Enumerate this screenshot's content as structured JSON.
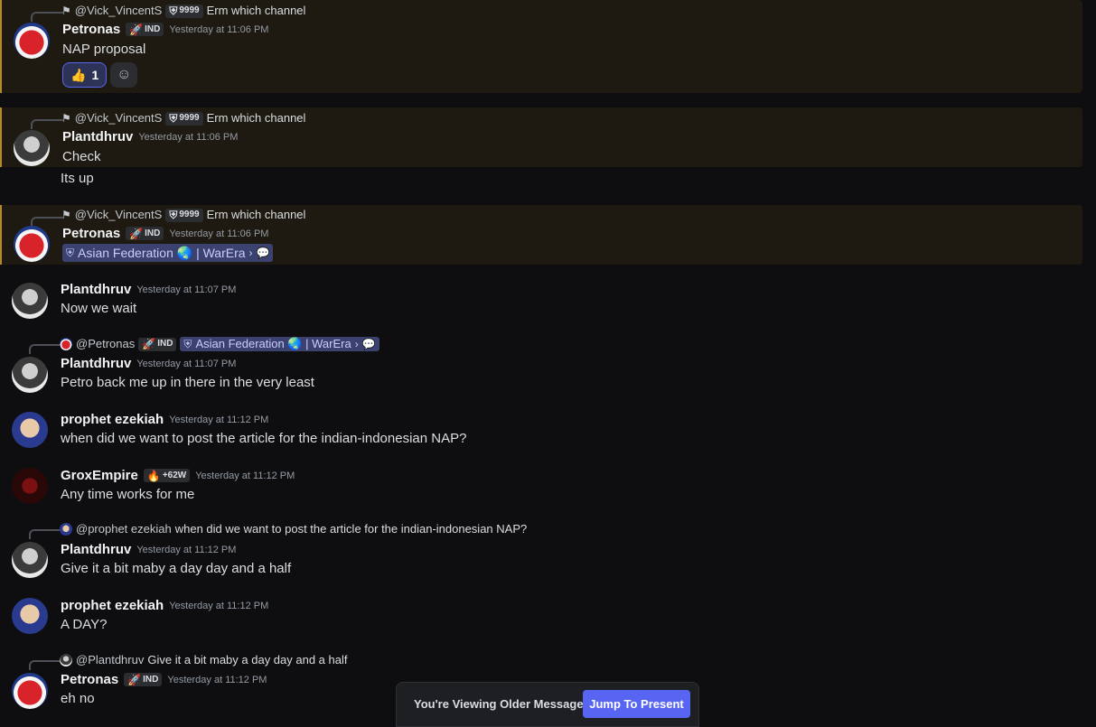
{
  "messages": [
    {
      "reply": {
        "user": "@Vick_VincentS",
        "tag": "9999",
        "text": "Erm which channel"
      },
      "user": "Petronas",
      "tag": "IND",
      "time": "Yesterday at 11:06 PM",
      "text": "NAP proposal",
      "reaction": {
        "emoji": "👍",
        "count": "1"
      }
    },
    {
      "reply": {
        "user": "@Vick_VincentS",
        "tag": "9999",
        "text": "Erm which channel"
      },
      "user": "Plantdhruv",
      "time": "Yesterday at 11:06 PM",
      "text": "Check",
      "followup": "Its up"
    },
    {
      "reply": {
        "user": "@Vick_VincentS",
        "tag": "9999",
        "text": "Erm which channel"
      },
      "user": "Petronas",
      "tag": "IND",
      "time": "Yesterday at 11:06 PM",
      "channel": "Asian Federation 🌏 | WarEra"
    },
    {
      "user": "Plantdhruv",
      "time": "Yesterday at 11:07 PM",
      "text": "Now we wait"
    },
    {
      "reply": {
        "user": "@Petronas",
        "tag": "IND",
        "channel": "Asian Federation 🌏 | WarEra"
      },
      "user": "Plantdhruv",
      "time": "Yesterday at 11:07 PM",
      "text": "Petro back me up in there in the very least"
    },
    {
      "user": "prophet ezekiah",
      "time": "Yesterday at 11:12 PM",
      "text": "when did we want to post the article for the indian-indonesian NAP?"
    },
    {
      "user": "GroxEmpire",
      "tag": "+62W",
      "time": "Yesterday at 11:12 PM",
      "text": "Any time works for me"
    },
    {
      "reply": {
        "user": "@prophet ezekiah",
        "text": "when did we want to post the article for the indian-indonesian NAP?"
      },
      "user": "Plantdhruv",
      "time": "Yesterday at 11:12 PM",
      "text": "Give it a bit maby a day day and a half"
    },
    {
      "user": "prophet ezekiah",
      "time": "Yesterday at 11:12 PM",
      "text": "A DAY?"
    },
    {
      "reply": {
        "user": "@Plantdhruv",
        "text": "Give it a bit maby a day day and a half"
      },
      "user": "Petronas",
      "tag": "IND",
      "time": "Yesterday at 11:12 PM",
      "text": "eh no"
    }
  ],
  "older_bar": {
    "text": "You're Viewing Older Messages",
    "button": "Jump To Present"
  },
  "colors": {
    "accent": "#5865f2",
    "highlight": "#1e1a12",
    "highlight_border": "#b58a2a"
  }
}
